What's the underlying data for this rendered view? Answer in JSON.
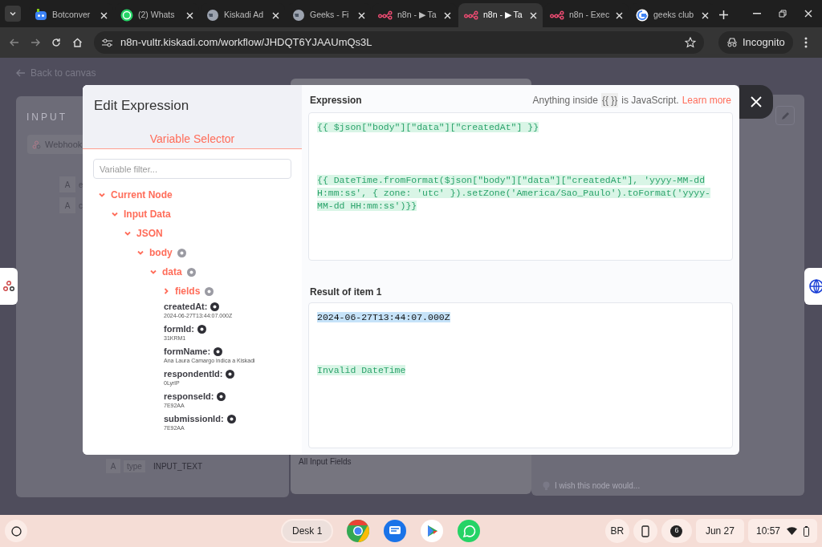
{
  "browser": {
    "tabs": [
      {
        "title": "Botconver",
        "kind": "bot",
        "selected": false
      },
      {
        "title": "(2) Whats",
        "kind": "chat",
        "selected": false
      },
      {
        "title": "Kiskadi Ad",
        "kind": "web",
        "selected": false
      },
      {
        "title": "Geeks - Fi",
        "kind": "web",
        "selected": false
      },
      {
        "title": "n8n - ▶ Ta",
        "kind": "graph",
        "selected": false
      },
      {
        "title": "n8n - ▶ Ta",
        "kind": "graph",
        "selected": true
      },
      {
        "title": "n8n - Exec",
        "kind": "graph",
        "selected": false
      },
      {
        "title": "geeks club",
        "kind": "search",
        "selected": false
      }
    ],
    "url": "n8n-vultr.kiskadi.com/workflow/JHDQT6YJAAUmQs3L",
    "profile": "Incognito"
  },
  "background": {
    "back_link": "Back to canvas",
    "input_title": "INPUT",
    "node_name": "Webhook",
    "rows": [
      {
        "type": "A",
        "key": "e"
      },
      {
        "type": "A",
        "key": "c"
      }
    ],
    "last_row": {
      "type": "A",
      "key": "type",
      "value": "INPUT_TEXT"
    },
    "middle_field": "All Input Fields",
    "feedback": "I wish this node would..."
  },
  "modal": {
    "title": "Edit Expression",
    "tab": "Variable Selector",
    "filter_placeholder": "Variable filter...",
    "tree": [
      {
        "kind": "branch",
        "label": "Current Node",
        "expanded": true,
        "children": [
          {
            "kind": "branch",
            "label": "Input Data",
            "expanded": true,
            "children": [
              {
                "kind": "branch",
                "label": "JSON",
                "expanded": true,
                "children": [
                  {
                    "kind": "branch",
                    "label": "body",
                    "expanded": true,
                    "object": true,
                    "children": [
                      {
                        "kind": "branch",
                        "label": "data",
                        "expanded": true,
                        "object": true,
                        "children": [
                          {
                            "kind": "branch",
                            "label": "fields",
                            "expanded": false,
                            "object": true
                          },
                          {
                            "kind": "leaf",
                            "label": "createdAt:",
                            "value": "2024-06-27T13:44:07.000Z"
                          },
                          {
                            "kind": "leaf",
                            "label": "formId:",
                            "value": "31KRM1"
                          },
                          {
                            "kind": "leaf",
                            "label": "formName:",
                            "value": "Ana Laura Camargo indica a Kiskadi"
                          },
                          {
                            "kind": "leaf",
                            "label": "respondentId:",
                            "value": "0LyrlP"
                          },
                          {
                            "kind": "leaf",
                            "label": "responseId:",
                            "value": "7E92AA"
                          },
                          {
                            "kind": "leaf",
                            "label": "submissionId:",
                            "value": "7E92AA"
                          }
                        ]
                      }
                    ]
                  }
                ]
              }
            ]
          }
        ]
      }
    ],
    "expression_label": "Expression",
    "hint": "Anything inside",
    "hint_code": "{{ }}",
    "hint_tail": "is JavaScript.",
    "learn_more": "Learn more",
    "expression_lines": [
      {
        "text": "{{ $json[\"body\"][\"data\"][\"createdAt\"] }}"
      },
      {
        "text": "{{ DateTime.fromFormat($json[\"body\"][\"data\"][\"createdAt\"], 'yyyy-MM-dd H:mm:ss', { zone: 'utc' }).setZone('America/Sao_Paulo').toFormat('yyyy-MM-dd HH:mm:ss')}}"
      }
    ],
    "result_label": "Result of item 1",
    "results": [
      {
        "text": "2024-06-27T13:44:07.000Z",
        "selected": true
      },
      {
        "text": "Invalid DateTime",
        "selected": false
      }
    ]
  },
  "taskbar": {
    "desk": "Desk 1",
    "apps": [
      {
        "kind": "chrome"
      },
      {
        "kind": "messages"
      },
      {
        "kind": "play"
      },
      {
        "kind": "whatsapp"
      }
    ],
    "keyboard": "BR",
    "notifications": "6",
    "date": "Jun 27",
    "time": "10:57"
  }
}
